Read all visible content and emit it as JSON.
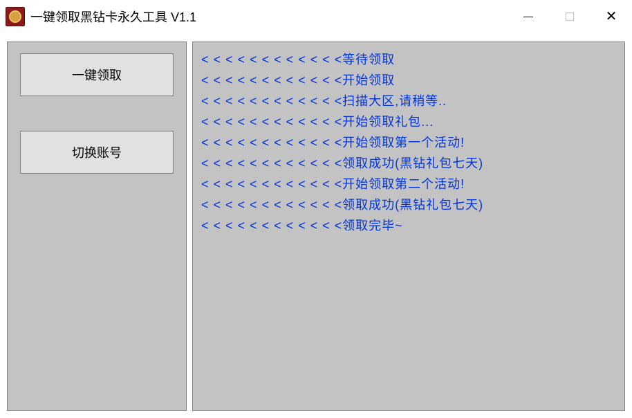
{
  "window": {
    "title": "一键领取黑钻卡永久工具 V1.1"
  },
  "buttons": {
    "oneClickReceive": "一键领取",
    "switchAccount": "切换账号"
  },
  "logPrefix": "< < < < < < < < < < < <",
  "logLines": [
    "等待领取",
    "开始领取",
    "扫描大区,请稍等..",
    "开始领取礼包...",
    "开始领取第一个活动!",
    "领取成功(黑钻礼包七天)",
    "开始领取第二个活动!",
    "领取成功(黑钻礼包七天)",
    "领取完毕~"
  ]
}
